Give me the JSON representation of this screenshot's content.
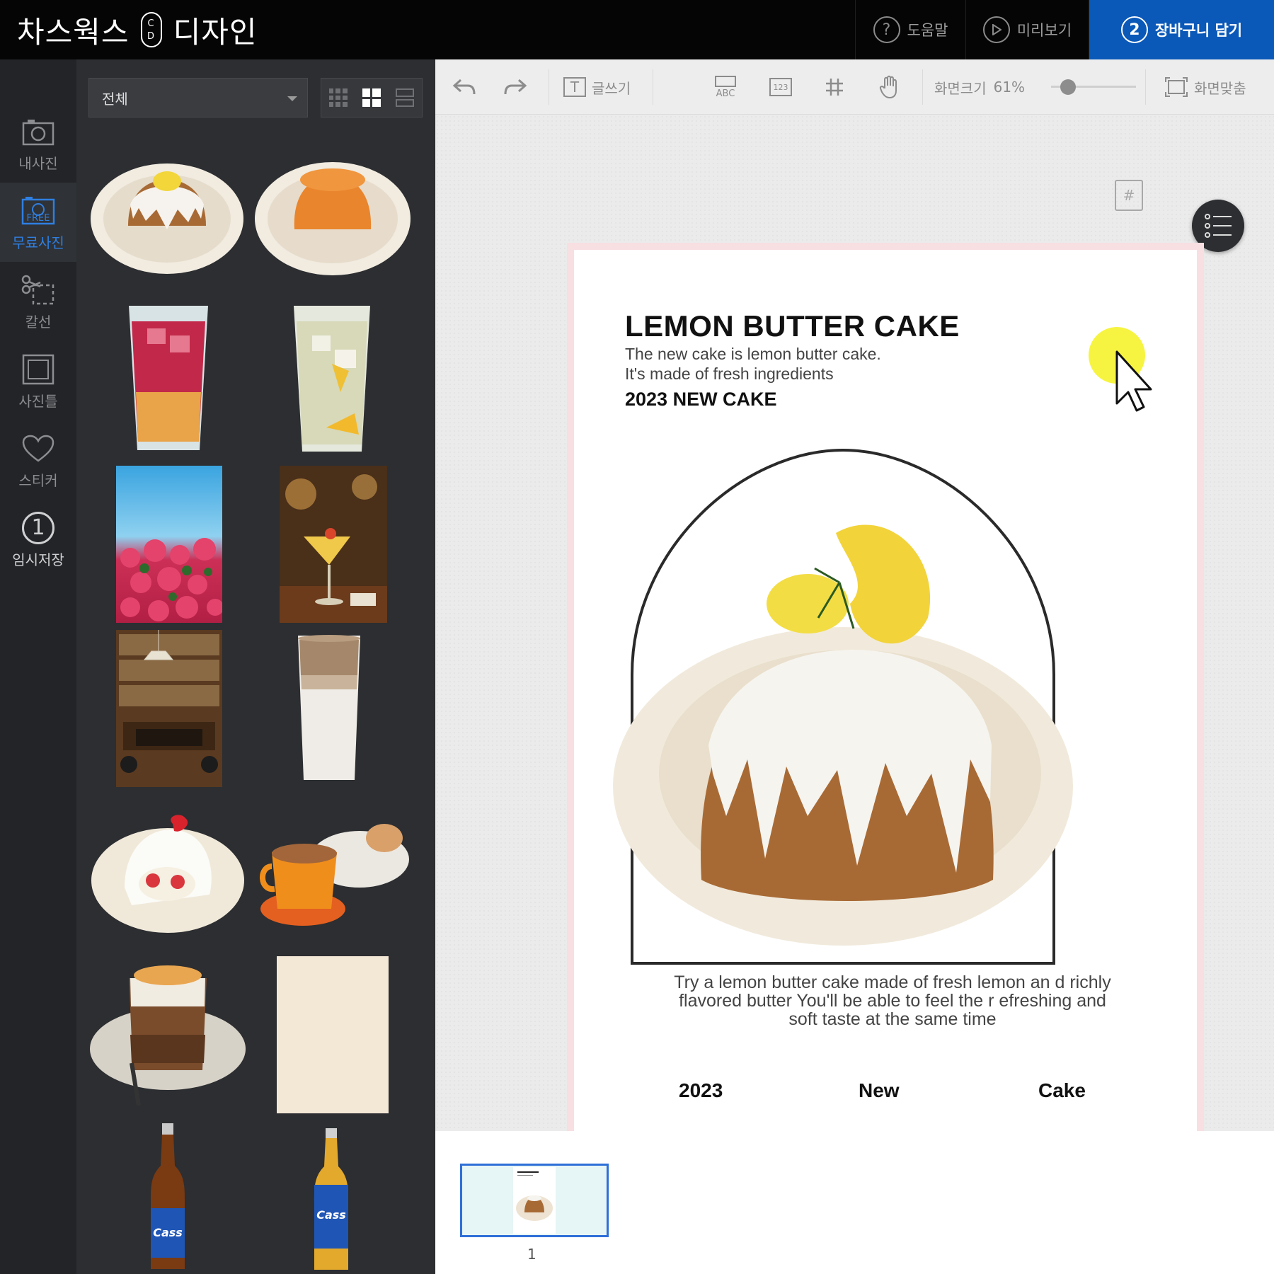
{
  "header": {
    "logo_left": "차스웍스",
    "logo_mark_top": "C",
    "logo_mark_bottom": "D",
    "logo_right": "디자인",
    "help_label": "도움말",
    "help_icon": "question-icon",
    "preview_label": "미리보기",
    "preview_icon": "play-icon",
    "cart_step": "2",
    "cart_label": "장바구니 담기"
  },
  "sidebar": {
    "tools": [
      {
        "label": "내사진",
        "icon": "camera-icon"
      },
      {
        "label": "무료사진",
        "icon": "free-photo-icon",
        "badge": "FREE",
        "active": true
      },
      {
        "label": "칼선",
        "icon": "scissors-icon"
      },
      {
        "label": "사진틀",
        "icon": "frame-icon"
      },
      {
        "label": "스티커",
        "icon": "heart-icon"
      },
      {
        "label": "임시저장",
        "icon": "save-number-icon",
        "number": "1"
      }
    ]
  },
  "panel": {
    "filter_value": "전체",
    "view_modes": [
      "small-grid",
      "large-grid",
      "list"
    ],
    "active_view": "large-grid",
    "photos": [
      "lemon-cake",
      "orange-cake",
      "red-ade",
      "lemon-ade",
      "flowers-sky",
      "cocktail",
      "record-room",
      "latte",
      "strawberry-roll",
      "coffee-cup",
      "creme-brulee-latte",
      "paper-texture",
      "cass-bottle",
      "cass-bottle-2"
    ]
  },
  "toolbar": {
    "undo_icon": "undo-icon",
    "redo_icon": "redo-icon",
    "text_label": "글쓰기",
    "abc_label": "ABC",
    "num_label": "123",
    "grid_icon": "grid-icon",
    "hand_icon": "hand-icon",
    "zoom_label": "화면크기",
    "zoom_value": "61%",
    "zoom_level": 0.2,
    "fit_label": "화면맞춤"
  },
  "canvas": {
    "page_icon_label": "#",
    "list_icon": "list-icon"
  },
  "poster": {
    "title": "LEMON BUTTER CAKE",
    "subtitle_1": "The new cake is lemon butter cake.",
    "subtitle_2": "It's made of fresh ingredients",
    "tagline": "2023 NEW CAKE",
    "description": "Try a lemon butter cake made of fresh lemon an d richly flavored butter You'll be able to feel the r efreshing and soft taste at the same time",
    "footer": [
      "2023",
      "New",
      "Cake"
    ]
  },
  "pages": {
    "current_page": "1"
  },
  "colors": {
    "accent": "#0a58b8",
    "active_tool": "#2f7fe0",
    "poster_border": "#f7dfe2",
    "cursor_highlight": "#f3f000"
  }
}
